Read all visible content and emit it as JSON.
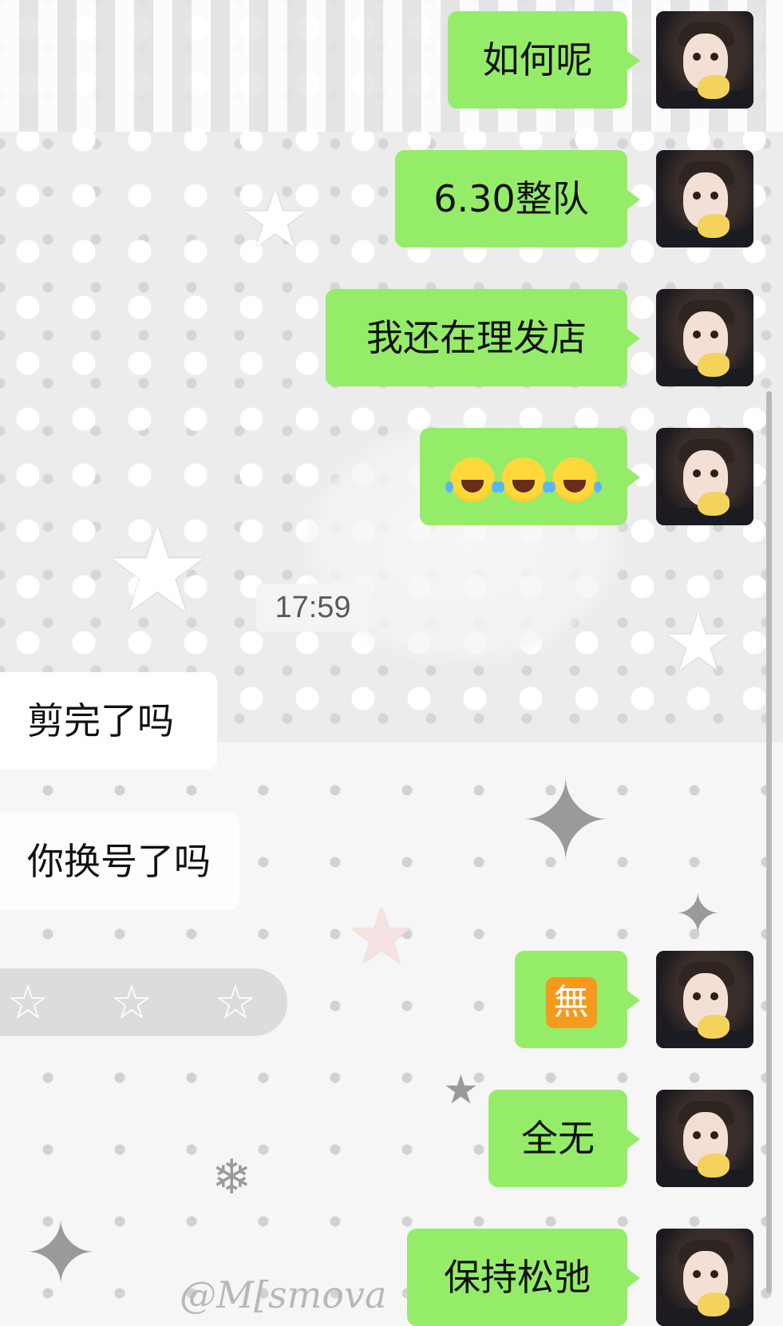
{
  "chat": {
    "messages": [
      {
        "side": "sent",
        "text": "如何呢"
      },
      {
        "side": "sent",
        "text": "6.30整队"
      },
      {
        "side": "sent",
        "text": "我还在理发店"
      },
      {
        "side": "sent",
        "emoji": "face-with-tears-of-joy",
        "count": 3
      },
      {
        "side": "received",
        "text": "剪完了吗"
      },
      {
        "side": "received",
        "text": "你换号了吗"
      },
      {
        "side": "sent",
        "emoji": "no-charge-button",
        "glyph": "無"
      },
      {
        "side": "sent",
        "text": "全无"
      },
      {
        "side": "sent",
        "text": "保持松弛"
      }
    ],
    "timestamp": "17:59"
  },
  "wallpaper": {
    "watermark": "@M[smova"
  },
  "colors": {
    "sent_bubble": "#95ec69",
    "received_bubble": "#ffffff",
    "emoji_badge": "#f59a1d"
  }
}
